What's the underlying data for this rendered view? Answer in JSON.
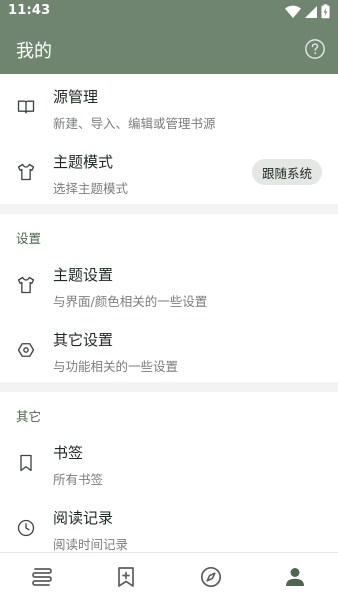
{
  "status": {
    "time": "11:43"
  },
  "appbar": {
    "title": "我的"
  },
  "sections": {
    "source": {
      "title": "源管理",
      "subtitle": "新建、导入、编辑或管理书源"
    },
    "theme_mode": {
      "title": "主题模式",
      "subtitle": "选择主题模式",
      "value": "跟随系统"
    },
    "settings_header": "设置",
    "theme_settings": {
      "title": "主题设置",
      "subtitle": "与界面/颜色相关的一些设置"
    },
    "other_settings": {
      "title": "其它设置",
      "subtitle": "与功能相关的一些设置"
    },
    "other_header": "其它",
    "bookmarks": {
      "title": "书签",
      "subtitle": "所有书签"
    },
    "read_record": {
      "title": "阅读记录",
      "subtitle": "阅读时间记录"
    }
  },
  "bottom_nav": [
    {
      "icon": "bookshelf-icon",
      "active": false
    },
    {
      "icon": "bookmark-add-icon",
      "active": false
    },
    {
      "icon": "compass-icon",
      "active": false
    },
    {
      "icon": "person-icon",
      "active": true
    }
  ],
  "colors": {
    "primary": "#6f8570",
    "active": "#4f6550",
    "inactive": "#5c5f5c"
  }
}
